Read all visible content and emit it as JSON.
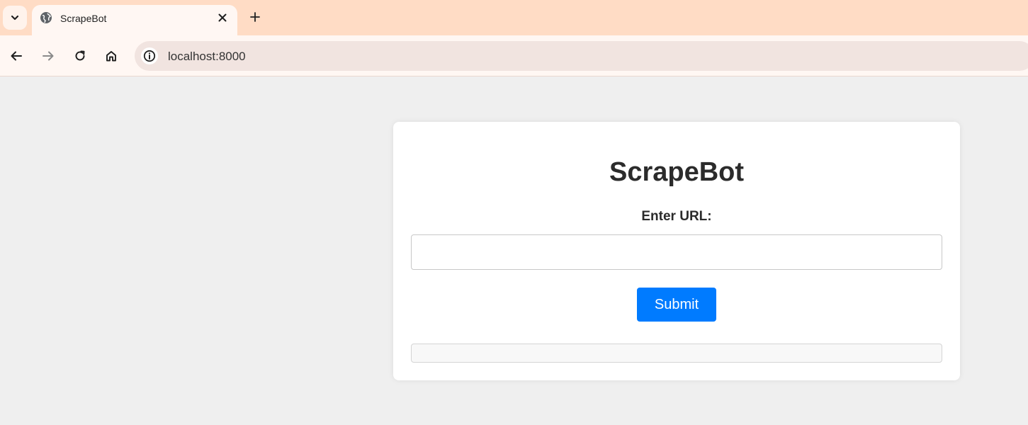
{
  "browser": {
    "tab_title": "ScrapeBot",
    "url": "localhost:8000"
  },
  "page": {
    "title": "ScrapeBot",
    "url_label": "Enter URL:",
    "url_input_value": "",
    "submit_label": "Submit",
    "result_text": ""
  },
  "colors": {
    "tabstrip": "#ffdcc5",
    "toolbar": "#fff7f3",
    "page_bg": "#efefef",
    "card_bg": "#ffffff",
    "button": "#007bff"
  },
  "icons": {
    "tab_search": "chevron-down-icon",
    "favicon": "globe-icon",
    "tab_close": "close-icon",
    "new_tab": "plus-icon",
    "back": "arrow-left-icon",
    "forward": "arrow-right-icon",
    "reload": "reload-icon",
    "home": "home-icon",
    "site_info": "info-icon"
  }
}
